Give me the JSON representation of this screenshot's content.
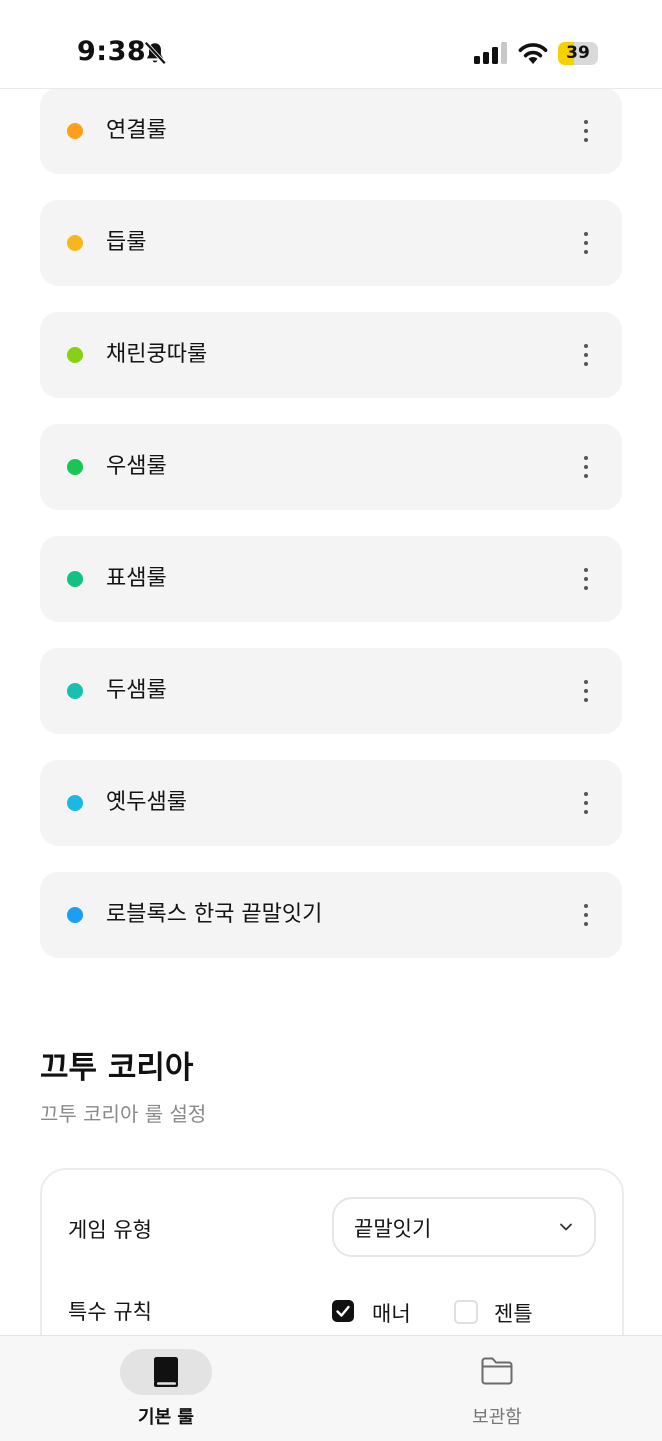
{
  "status": {
    "time": "9:38",
    "battery": "39",
    "battery_level": 0.39
  },
  "rules": [
    {
      "label": "연결룰",
      "color": "#ff9f1a"
    },
    {
      "label": "듭룰",
      "color": "#f5b71c"
    },
    {
      "label": "채린쿵따룰",
      "color": "#86d112"
    },
    {
      "label": "우샘룰",
      "color": "#17c653"
    },
    {
      "label": "표샘룰",
      "color": "#12c284"
    },
    {
      "label": "두샘룰",
      "color": "#17c1b0"
    },
    {
      "label": "옛두샘룰",
      "color": "#19b9e6"
    },
    {
      "label": "로블록스 한국 끝말잇기",
      "color": "#1a9ff5"
    }
  ],
  "section": {
    "title": "끄투 코리아",
    "subtitle": "끄투 코리아 룰 설정"
  },
  "settings": {
    "game_type_label": "게임 유형",
    "game_type_value": "끝말잇기",
    "special_rules_label": "특수 규칙",
    "options": [
      {
        "label": "매너",
        "checked": true
      },
      {
        "label": "젠틀",
        "checked": false
      }
    ]
  },
  "nav": {
    "items": [
      {
        "label": "기본 룰",
        "active": true
      },
      {
        "label": "보관함",
        "active": false
      }
    ]
  }
}
